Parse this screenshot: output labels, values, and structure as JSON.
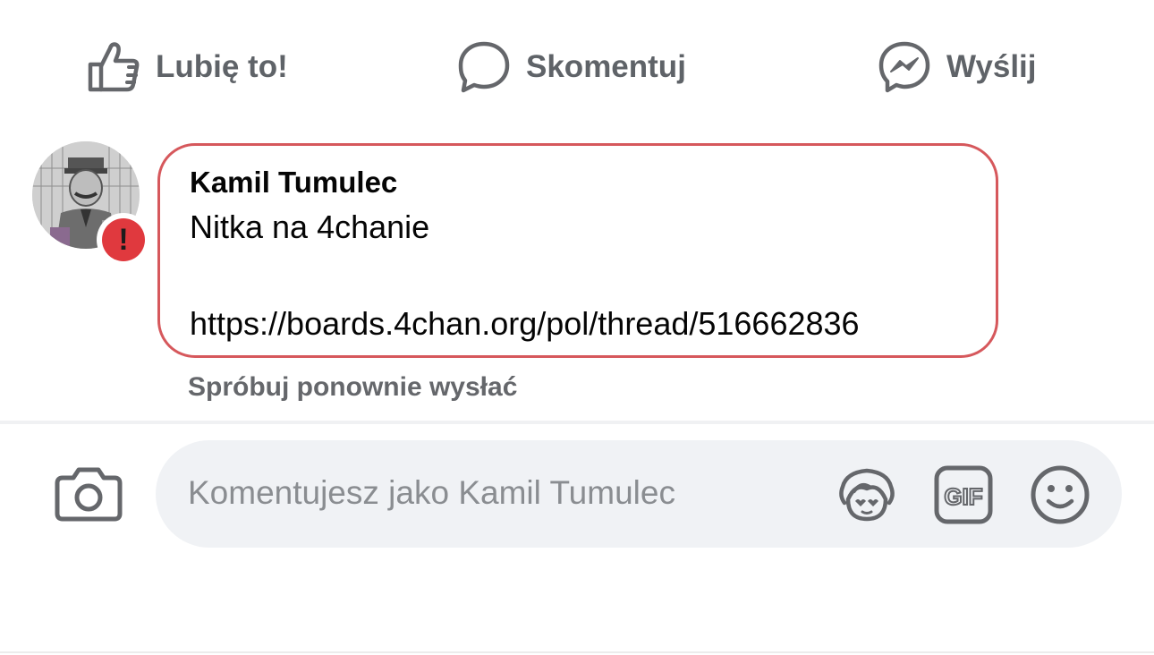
{
  "actions": {
    "like_label": "Lubię to!",
    "comment_label": "Skomentuj",
    "send_label": "Wyślij"
  },
  "comment": {
    "author": "Kamil Tumulec",
    "text_line1": "Nitka na 4chanie",
    "text_line2": "https://boards.4chan.org/pol/thread/516662836",
    "error_icon": "!",
    "retry_label": "Spróbuj ponownie wysłać"
  },
  "composer": {
    "placeholder": "Komentujesz jako Kamil Tumulec",
    "gif_label": "GIF"
  },
  "colors": {
    "error_border": "#d6585c",
    "error_badge": "#e0393e",
    "composer_bg": "#f0f2f5",
    "muted_text": "#65676b"
  },
  "icons": [
    "thumbs-up-icon",
    "comment-bubble-icon",
    "messenger-icon",
    "camera-icon",
    "avatar-sticker-icon",
    "gif-icon",
    "emoji-icon",
    "error-icon"
  ]
}
